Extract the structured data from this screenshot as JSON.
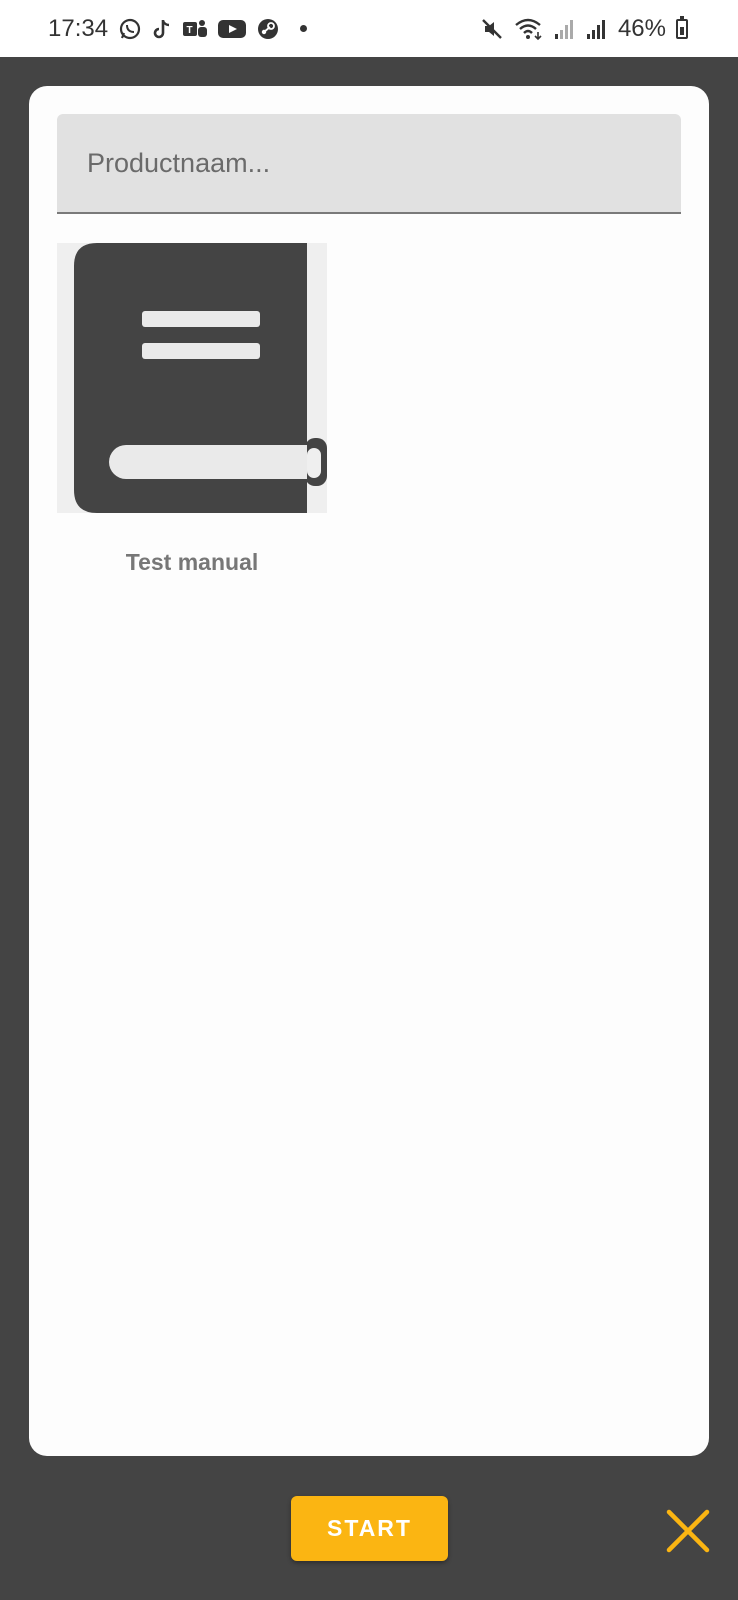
{
  "status_bar": {
    "time": "17:34",
    "battery_percent": "46%",
    "notification_icons": [
      "whatsapp-icon",
      "tiktok-icon",
      "teams-icon",
      "youtube-icon",
      "steam-icon"
    ],
    "system_icons": [
      "mute-icon",
      "wifi-icon",
      "signal-icon",
      "signal-icon",
      "battery-icon"
    ]
  },
  "search": {
    "placeholder": "Productnaam...",
    "value": ""
  },
  "products": [
    {
      "name": "Test manual",
      "icon": "book-icon"
    }
  ],
  "actions": {
    "start_label": "START",
    "close_icon": "close-icon"
  },
  "colors": {
    "background": "#444444",
    "card": "#fdfdfd",
    "search_field": "#e1e1e1",
    "accent": "#fbb512",
    "icon": "#444444"
  }
}
